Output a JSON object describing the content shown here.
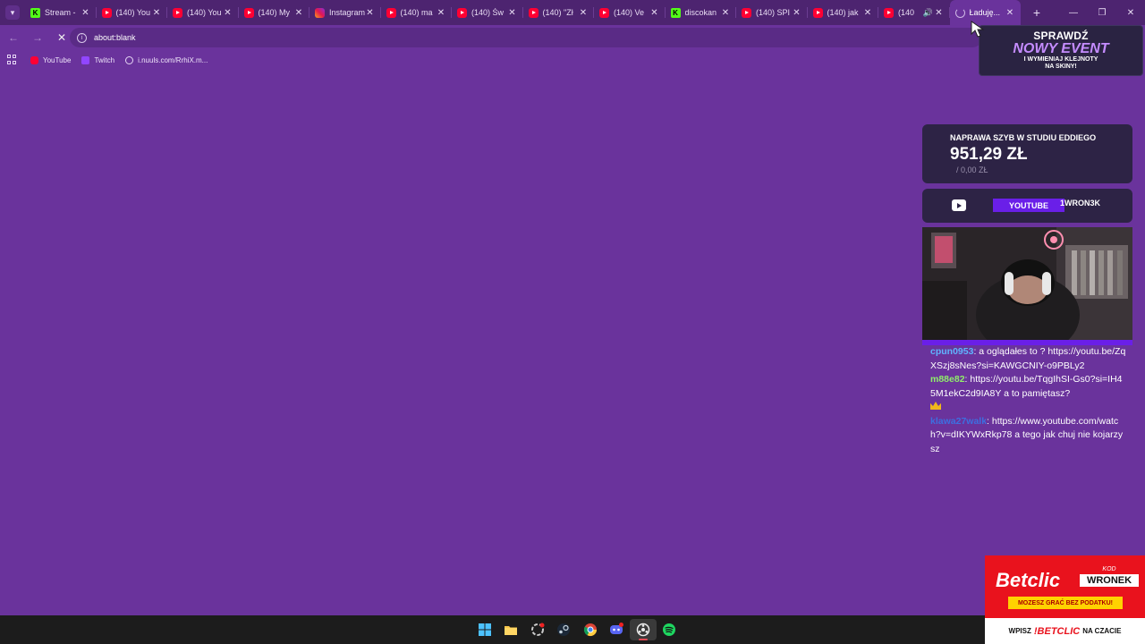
{
  "browser": {
    "tabs": [
      {
        "title": "Stream -",
        "favicon": "kick-icon"
      },
      {
        "title": "(140) You",
        "favicon": "youtube-icon"
      },
      {
        "title": "(140) You",
        "favicon": "youtube-icon"
      },
      {
        "title": "(140) My",
        "favicon": "youtube-icon"
      },
      {
        "title": "Instagram",
        "favicon": "instagram-icon"
      },
      {
        "title": "(140) ma",
        "favicon": "youtube-icon"
      },
      {
        "title": "(140) Św",
        "favicon": "youtube-icon"
      },
      {
        "title": "(140) \"Zł",
        "favicon": "youtube-icon"
      },
      {
        "title": "(140) Ve",
        "favicon": "youtube-icon"
      },
      {
        "title": "discokan",
        "favicon": "kick-icon"
      },
      {
        "title": "(140) SPI",
        "favicon": "youtube-icon"
      },
      {
        "title": "(140) jak",
        "favicon": "youtube-icon"
      },
      {
        "title": "(140",
        "favicon": "youtube-icon",
        "audio": true
      },
      {
        "title": "Ładuję...",
        "favicon": "loading-spinner-icon",
        "active": true
      }
    ],
    "new_tab_label": "+",
    "address": {
      "url": "about:blank"
    },
    "bookmarks": [
      {
        "label": "YouTube",
        "icon": "youtube-icon"
      },
      {
        "label": "Twitch",
        "icon": "twitch-icon"
      },
      {
        "label": "i.nuuls.com/RrhiX.m...",
        "icon": "globe-icon"
      }
    ]
  },
  "overlay": {
    "event": {
      "line1": "SPRAWDŹ",
      "line2": "NOWY EVENT",
      "line3a": "I WYMIENIAJ KLEJNOTY",
      "line3b": "NA SKINY!"
    },
    "goal": {
      "title": "NAPRAWA SZYB W STUDIU EDDIEGO",
      "amount": "951,29 ZŁ",
      "sub": "/ 0,00 ZŁ"
    },
    "social": {
      "platform": "YOUTUBE",
      "channel": "1WRON3K"
    },
    "chat": [
      {
        "user": "cpun0953",
        "user_color": "#5fb4ff",
        "text": ": a oglądałes to ? https://youtu.be/ZqXSzj8sNes?si=KAWGCNIY-o9PBLy2"
      },
      {
        "user": "m88e82",
        "user_color": "#8fee6a",
        "text": ": https://youtu.be/TqgIhSI-Gs0?si=IH45M1ekC2d9IA8Y a to pamiętasz?",
        "crown": true
      },
      {
        "user": "klawa27walk",
        "user_color": "#3d6fe0",
        "text": ": https://www.youtube.com/watch?v=dIKYWxRkp78 a tego jak chuj nie kojarzysz"
      }
    ],
    "betclic": {
      "logo": "Betclic",
      "kod_label": "KOD",
      "kod": "WRONEK",
      "tagline": "MOZESZ GRAĆ BEZ PODATKU!",
      "bottom_pre": "WPISZ",
      "bottom_brand": "!BETCLIC",
      "bottom_post": "NA CZACIE"
    }
  },
  "colors": {
    "page_bg": "#6a339c",
    "accent": "#6a1fe8",
    "betclic_red": "#e9121d"
  }
}
